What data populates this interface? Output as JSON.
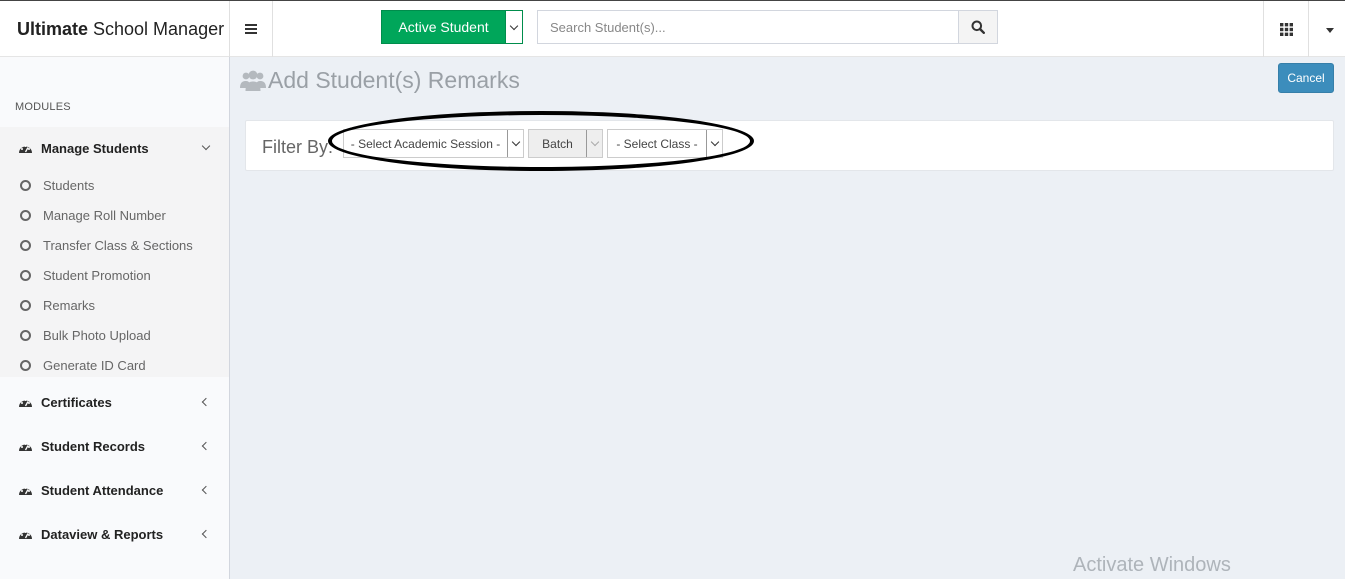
{
  "header": {
    "brand_bold": "Ultimate",
    "brand_rest": "School Manager",
    "active_button_label": "Active Student",
    "search_placeholder": "Search Student(s)..."
  },
  "sidebar": {
    "modules_header": "MODULES",
    "manage_students": {
      "label": "Manage Students",
      "items": [
        "Students",
        "Manage Roll Number",
        "Transfer Class & Sections",
        "Student Promotion",
        "Remarks",
        "Bulk Photo Upload",
        "Generate ID Card"
      ]
    },
    "menus": [
      "Certificates",
      "Student Records",
      "Student Attendance",
      "Dataview & Reports"
    ]
  },
  "main": {
    "title": "Add Student(s) Remarks",
    "cancel_label": "Cancel",
    "filter_label": "Filter By:",
    "session_select": "- Select Academic Session -",
    "batch_select": "Batch",
    "class_select": "- Select Class -"
  },
  "watermark": "Activate Windows",
  "colors": {
    "success": "#00a65a",
    "primary": "#3c8dbc",
    "background": "#ecf0f5"
  }
}
